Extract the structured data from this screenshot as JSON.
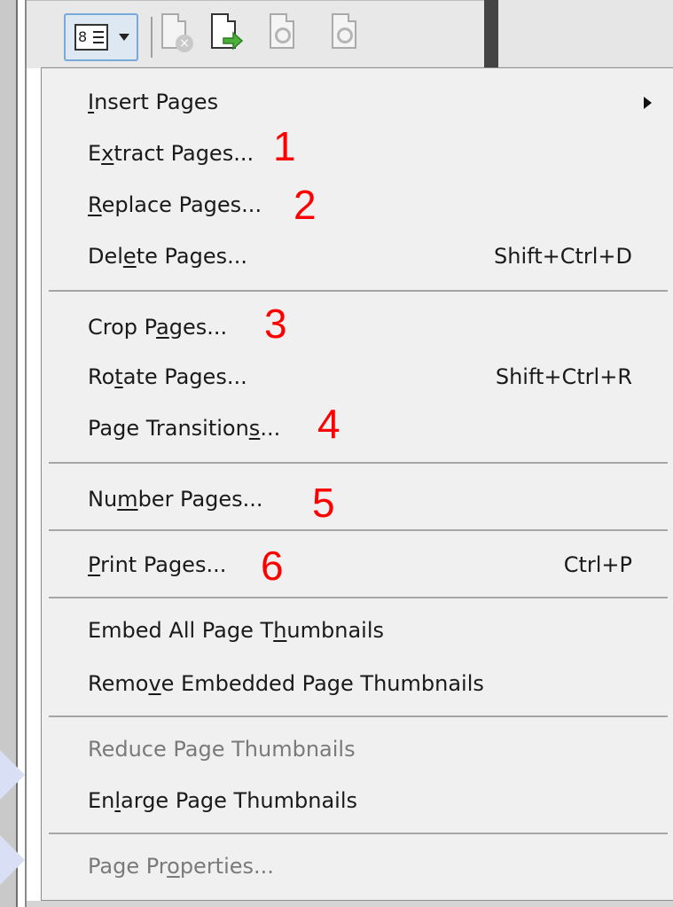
{
  "menu": {
    "items": [
      {
        "pre": "",
        "ul": "I",
        "post": "nsert Pages",
        "shortcut": "",
        "submenu": true,
        "disabled": false
      },
      {
        "pre": "E",
        "ul": "x",
        "post": "tract Pages...",
        "shortcut": "",
        "submenu": false,
        "disabled": false
      },
      {
        "pre": "",
        "ul": "R",
        "post": "eplace Pages...",
        "shortcut": "",
        "submenu": false,
        "disabled": false
      },
      {
        "pre": "Del",
        "ul": "e",
        "post": "te Pages...",
        "shortcut": "Shift+Ctrl+D",
        "submenu": false,
        "disabled": false
      },
      {
        "pre": "Crop P",
        "ul": "a",
        "post": "ges...",
        "shortcut": "",
        "submenu": false,
        "disabled": false
      },
      {
        "pre": "Ro",
        "ul": "t",
        "post": "ate Pages...",
        "shortcut": "Shift+Ctrl+R",
        "submenu": false,
        "disabled": false
      },
      {
        "pre": "Page Transition",
        "ul": "s",
        "post": "...",
        "shortcut": "",
        "submenu": false,
        "disabled": false
      },
      {
        "pre": "Nu",
        "ul": "m",
        "post": "ber Pages...",
        "shortcut": "",
        "submenu": false,
        "disabled": false
      },
      {
        "pre": "",
        "ul": "P",
        "post": "rint Pages...",
        "shortcut": "Ctrl+P",
        "submenu": false,
        "disabled": false
      },
      {
        "pre": "Embed All Page T",
        "ul": "h",
        "post": "umbnails",
        "shortcut": "",
        "submenu": false,
        "disabled": false
      },
      {
        "pre": "Remo",
        "ul": "v",
        "post": "e Embedded Page Thumbnails",
        "shortcut": "",
        "submenu": false,
        "disabled": false
      },
      {
        "pre": "Reduce Page Thumbnails",
        "ul": "",
        "post": "",
        "shortcut": "",
        "submenu": false,
        "disabled": true
      },
      {
        "pre": "En",
        "ul": "l",
        "post": "arge Page Thumbnails",
        "shortcut": "",
        "submenu": false,
        "disabled": false
      },
      {
        "pre": "Page Pr",
        "ul": "o",
        "post": "perties...",
        "shortcut": "",
        "submenu": false,
        "disabled": true
      }
    ]
  },
  "annotations": [
    "1",
    "2",
    "3",
    "4",
    "5",
    "6"
  ],
  "colors": {
    "annotation": "#ff0000",
    "menu_bg": "#f0f0f0",
    "disabled_text": "#7a7a7a"
  }
}
